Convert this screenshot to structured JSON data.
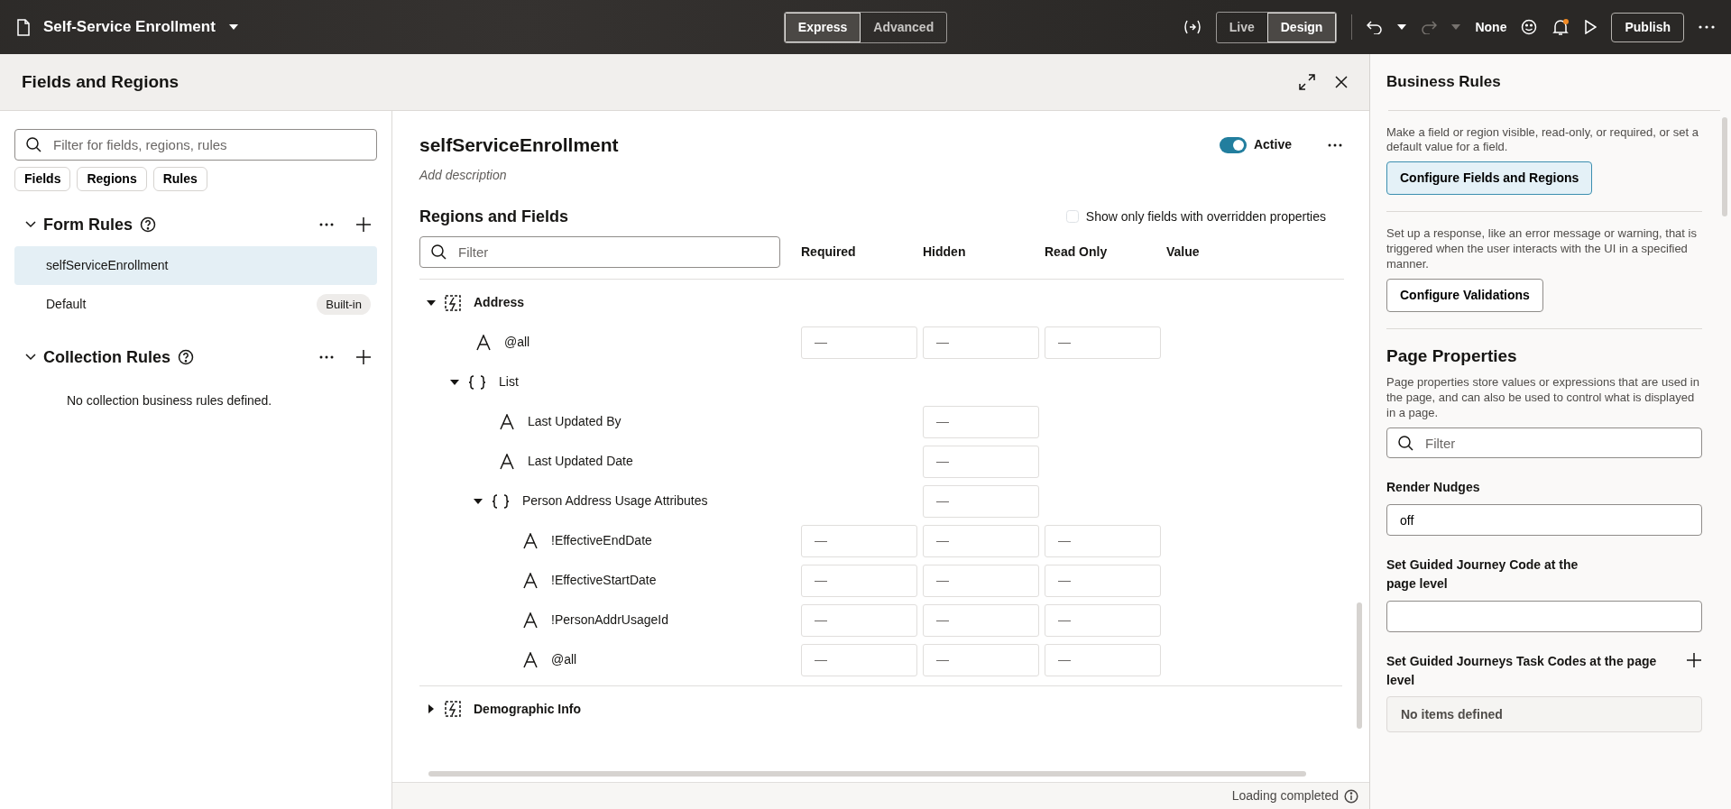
{
  "app_bar": {
    "title": "Self-Service Enrollment",
    "modes": [
      {
        "label": "Express",
        "selected": true
      },
      {
        "label": "Advanced",
        "selected": false
      }
    ],
    "views": [
      {
        "label": "Live",
        "selected": false
      },
      {
        "label": "Design",
        "selected": true
      }
    ],
    "redo_disabled": true,
    "context": "None",
    "has_notification": true,
    "publish": "Publish"
  },
  "dialog": {
    "title": "Fields and Regions"
  },
  "left": {
    "filter": {
      "placeholder": "Filter for fields, regions, rules"
    },
    "chips": [
      "Fields",
      "Regions",
      "Rules"
    ],
    "sections": [
      {
        "title": "Form Rules",
        "expanded": true,
        "items": [
          {
            "label": "selfServiceEnrollment",
            "selected": true
          },
          {
            "label": "Default",
            "badge": "Built-in",
            "selected": false
          }
        ]
      },
      {
        "title": "Collection Rules",
        "expanded": true,
        "empty_text": "No collection business rules defined."
      }
    ]
  },
  "rule": {
    "name": "selfServiceEnrollment",
    "description": "Add description",
    "active": true,
    "active_label": "Active"
  },
  "regions": {
    "title": "Regions and Fields",
    "override_filter": {
      "label": "Show only fields with overridden properties",
      "checked": false
    },
    "filter": {
      "placeholder": "Filter"
    },
    "columns": [
      "Required",
      "Hidden",
      "Read Only",
      "Value"
    ],
    "tree": [
      {
        "kind": "region",
        "label": "Address",
        "expanded": true,
        "children": [
          {
            "kind": "field",
            "label": "@all",
            "cells": {
              "required": "—",
              "hidden": "—",
              "read_only": "—"
            }
          },
          {
            "kind": "object",
            "label": "List",
            "expanded": true,
            "children": [
              {
                "kind": "field",
                "label": "Last Updated By",
                "cells": {
                  "hidden": "—"
                }
              },
              {
                "kind": "field",
                "label": "Last Updated Date",
                "cells": {
                  "hidden": "—"
                }
              },
              {
                "kind": "object",
                "label": "Person Address Usage Attributes",
                "expanded": true,
                "cells": {
                  "hidden": "—"
                },
                "children": [
                  {
                    "kind": "field",
                    "label": "!EffectiveEndDate",
                    "cells": {
                      "required": "—",
                      "hidden": "—",
                      "read_only": "—"
                    }
                  },
                  {
                    "kind": "field",
                    "label": "!EffectiveStartDate",
                    "cells": {
                      "required": "—",
                      "hidden": "—",
                      "read_only": "—"
                    }
                  },
                  {
                    "kind": "field",
                    "label": "!PersonAddrUsageId",
                    "cells": {
                      "required": "—",
                      "hidden": "—",
                      "read_only": "—"
                    }
                  },
                  {
                    "kind": "field",
                    "label": "@all",
                    "cells": {
                      "required": "—",
                      "hidden": "—",
                      "read_only": "—"
                    }
                  }
                ]
              }
            ]
          }
        ]
      },
      {
        "kind": "region",
        "label": "Demographic Info",
        "expanded": false
      }
    ]
  },
  "status": "Loading completed",
  "business_rules": {
    "title": "Business Rules",
    "blocks": [
      {
        "text": "Make a field or region visible, read-only, or required, or set a default value for a field.",
        "button": "Configure Fields and Regions",
        "highlighted": true
      },
      {
        "text": "Set up a response, like an error message or warning, that is triggered when the user interacts with the UI in a specified manner.",
        "button": "Configure Validations",
        "highlighted": false
      }
    ]
  },
  "page_properties": {
    "title": "Page Properties",
    "text": "Page properties store values or expressions that are used in the page, and can also be used to control what is displayed in a page.",
    "filter": {
      "placeholder": "Filter"
    },
    "fields": [
      {
        "kind": "input",
        "label": "Render Nudges",
        "value": "off"
      },
      {
        "kind": "input",
        "label": "Set Guided Journey Code at the page level"
      },
      {
        "kind": "list",
        "label": "Set Guided Journeys Task Codes at the page level",
        "empty_text": "No items defined"
      }
    ]
  }
}
